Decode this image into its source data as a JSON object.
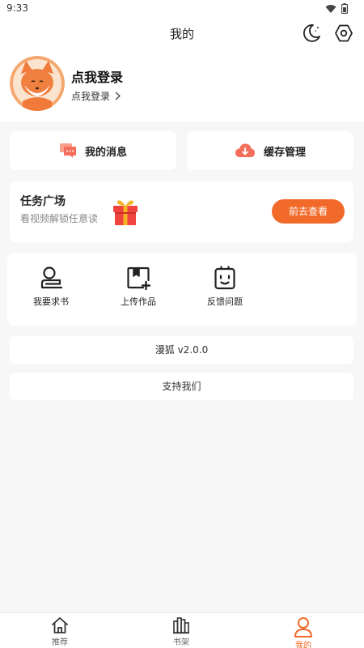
{
  "status_bar": {
    "time": "9:33"
  },
  "header": {
    "title": "我的"
  },
  "profile": {
    "name": "点我登录",
    "login_link": "点我登录"
  },
  "quick_actions": [
    {
      "label": "我的消息",
      "icon": "message-icon"
    },
    {
      "label": "缓存管理",
      "icon": "cloud-download-icon"
    }
  ],
  "task": {
    "title": "任务广场",
    "subtitle": "看视频解锁任意读",
    "button": "前去查看"
  },
  "tools": [
    {
      "label": "我要求书",
      "icon": "request-book-icon"
    },
    {
      "label": "上传作品",
      "icon": "upload-work-icon"
    },
    {
      "label": "反馈问题",
      "icon": "feedback-icon"
    }
  ],
  "version": "漫狐 v2.0.0",
  "support": "支持我们",
  "tab_bar": {
    "items": [
      {
        "label": "推荐",
        "icon": "home-icon"
      },
      {
        "label": "书架",
        "icon": "bookshelf-icon"
      },
      {
        "label": "我的",
        "icon": "user-icon",
        "active": true
      }
    ]
  },
  "colors": {
    "accent": "#f26a2a",
    "background": "#f7f7f7",
    "card": "#ffffff"
  }
}
